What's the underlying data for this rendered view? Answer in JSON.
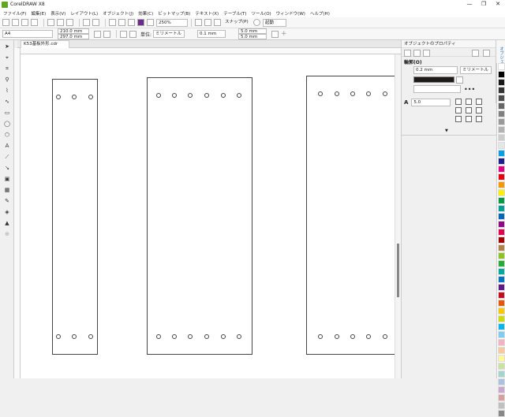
{
  "window": {
    "title": "CorelDRAW X8",
    "controls": [
      "—",
      "❐",
      "✕"
    ]
  },
  "menu": {
    "items": [
      "ファイル(F)",
      "編集(E)",
      "表示(V)",
      "レイアウト(L)",
      "オブジェクト(J)",
      "効果(C)",
      "ビットマップ(B)",
      "テキスト(X)",
      "テーブル(T)",
      "ツール(O)",
      "ウィンドウ(W)",
      "ヘルプ(H)"
    ]
  },
  "toolbar": {
    "zoom": "250%",
    "snap": "スナップ(P)",
    "launch": "起動"
  },
  "propbar": {
    "page_size": "A4",
    "width": "210.0 mm",
    "height": "297.0 mm",
    "unit_label": "単位:",
    "unit": "ミリメートル",
    "nudge": "0.1 mm",
    "dup_x": "5.0 mm",
    "dup_y": "5.0 mm"
  },
  "document": {
    "tab": "K53基板外形.cdr"
  },
  "docker": {
    "title": "オブジェクトのプロパティ",
    "section": "輪郭(O)",
    "outline_width": "0.2 mm",
    "outline_unit": "ミリメートル",
    "miter": "5.0",
    "side_tab": "オブジェクトのプロパティ"
  },
  "palette": {
    "colors": [
      "#ffffff",
      "#000000",
      "#1a1a1a",
      "#333333",
      "#4d4d4d",
      "#666666",
      "#808080",
      "#999999",
      "#b3b3b3",
      "#cccccc",
      "#e6e6e6",
      "#00a0e9",
      "#1d2088",
      "#e4007f",
      "#e60012",
      "#f39800",
      "#fff100",
      "#009944",
      "#009e96",
      "#0068b7",
      "#920783",
      "#e5004f",
      "#a40000",
      "#b28146",
      "#8fc31f",
      "#22ac38",
      "#00a99d",
      "#0075c2",
      "#601986",
      "#c30d23",
      "#ea5504",
      "#fcc800",
      "#cfdb00",
      "#00b7ee",
      "#7ecef4",
      "#f4b3c2",
      "#f8c9a0",
      "#fff799",
      "#c9e3a0",
      "#a3d6cc",
      "#abc1e4",
      "#c9a8d0",
      "#d6a0a0",
      "#c0c0c0",
      "#888888"
    ]
  }
}
